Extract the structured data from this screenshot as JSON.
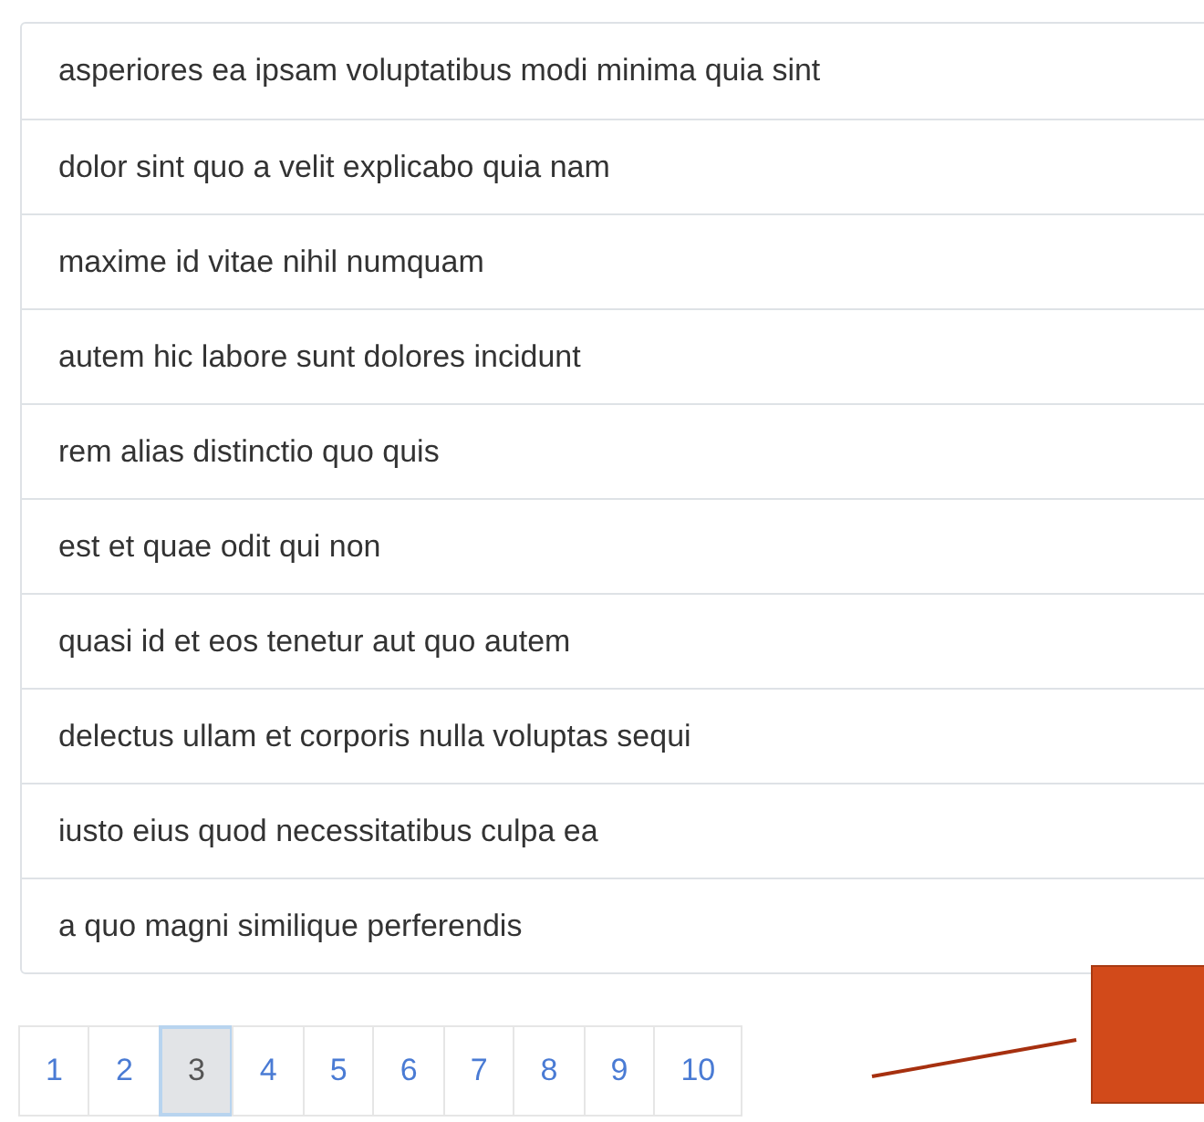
{
  "list_items": [
    "asperiores ea ipsam voluptatibus modi minima quia sint",
    "dolor sint quo a velit explicabo quia nam",
    "maxime id vitae nihil numquam",
    "autem hic labore sunt dolores incidunt",
    "rem alias distinctio quo quis",
    "est et quae odit qui non",
    "quasi id et eos tenetur aut quo autem",
    "delectus ullam et corporis nulla voluptas sequi",
    "iusto eius quod necessitatibus culpa ea",
    "a quo magni similique perferendis"
  ],
  "pagination": [
    {
      "label": "1",
      "selected": false
    },
    {
      "label": "2",
      "selected": false
    },
    {
      "label": "3",
      "selected": true
    },
    {
      "label": "4",
      "selected": false
    },
    {
      "label": "5",
      "selected": false
    },
    {
      "label": "6",
      "selected": false
    },
    {
      "label": "7",
      "selected": false
    },
    {
      "label": "8",
      "selected": false
    },
    {
      "label": "9",
      "selected": false
    },
    {
      "label": "10",
      "selected": false
    }
  ]
}
